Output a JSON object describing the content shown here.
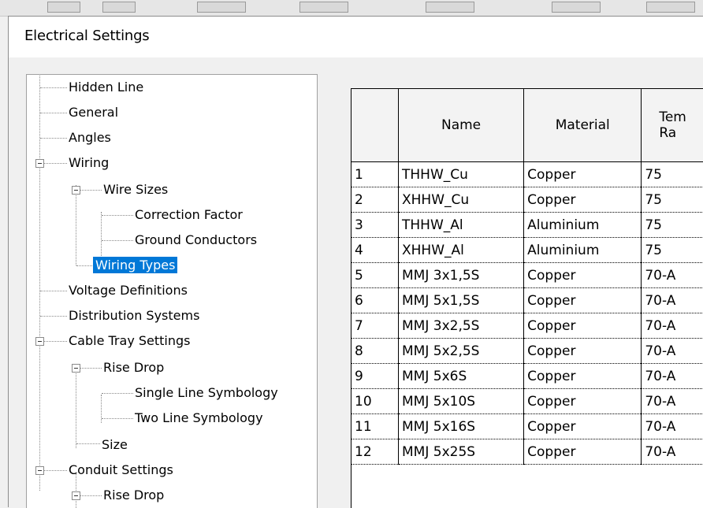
{
  "window": {
    "title": "Electrical Settings"
  },
  "tree": {
    "items": [
      {
        "label": "Hidden Line"
      },
      {
        "label": "General"
      },
      {
        "label": "Angles"
      },
      {
        "label": "Wiring"
      },
      {
        "label": "Wire Sizes"
      },
      {
        "label": "Correction Factor"
      },
      {
        "label": "Ground Conductors"
      },
      {
        "label": "Wiring Types",
        "selected": true
      },
      {
        "label": "Voltage Definitions"
      },
      {
        "label": "Distribution Systems"
      },
      {
        "label": "Cable Tray Settings"
      },
      {
        "label": "Rise Drop"
      },
      {
        "label": "Single Line Symbology"
      },
      {
        "label": "Two Line Symbology"
      },
      {
        "label": "Size"
      },
      {
        "label": "Conduit Settings"
      },
      {
        "label": "Rise Drop"
      }
    ]
  },
  "grid": {
    "columns": [
      "",
      "Name",
      "Material",
      "Tem Ra"
    ],
    "rows": [
      [
        "1",
        "THHW_Cu",
        "Copper",
        "75"
      ],
      [
        "2",
        "XHHW_Cu",
        "Copper",
        "75"
      ],
      [
        "3",
        "THHW_Al",
        "Aluminium",
        "75"
      ],
      [
        "4",
        "XHHW_Al",
        "Aluminium",
        "75"
      ],
      [
        "5",
        "MMJ 3x1,5S",
        "Copper",
        "70-A"
      ],
      [
        "6",
        "MMJ 5x1,5S",
        "Copper",
        "70-A"
      ],
      [
        "7",
        "MMJ 3x2,5S",
        "Copper",
        "70-A"
      ],
      [
        "8",
        "MMJ 5x2,5S",
        "Copper",
        "70-A"
      ],
      [
        "9",
        "MMJ 5x6S",
        "Copper",
        "70-A"
      ],
      [
        "10",
        "MMJ 5x10S",
        "Copper",
        "70-A"
      ],
      [
        "11",
        "MMJ 5x16S",
        "Copper",
        "70-A"
      ],
      [
        "12",
        "MMJ 5x25S",
        "Copper",
        "70-A"
      ]
    ]
  },
  "colors": {
    "selection": "#0078d7",
    "dialog_bg": "#f0f0f0"
  }
}
